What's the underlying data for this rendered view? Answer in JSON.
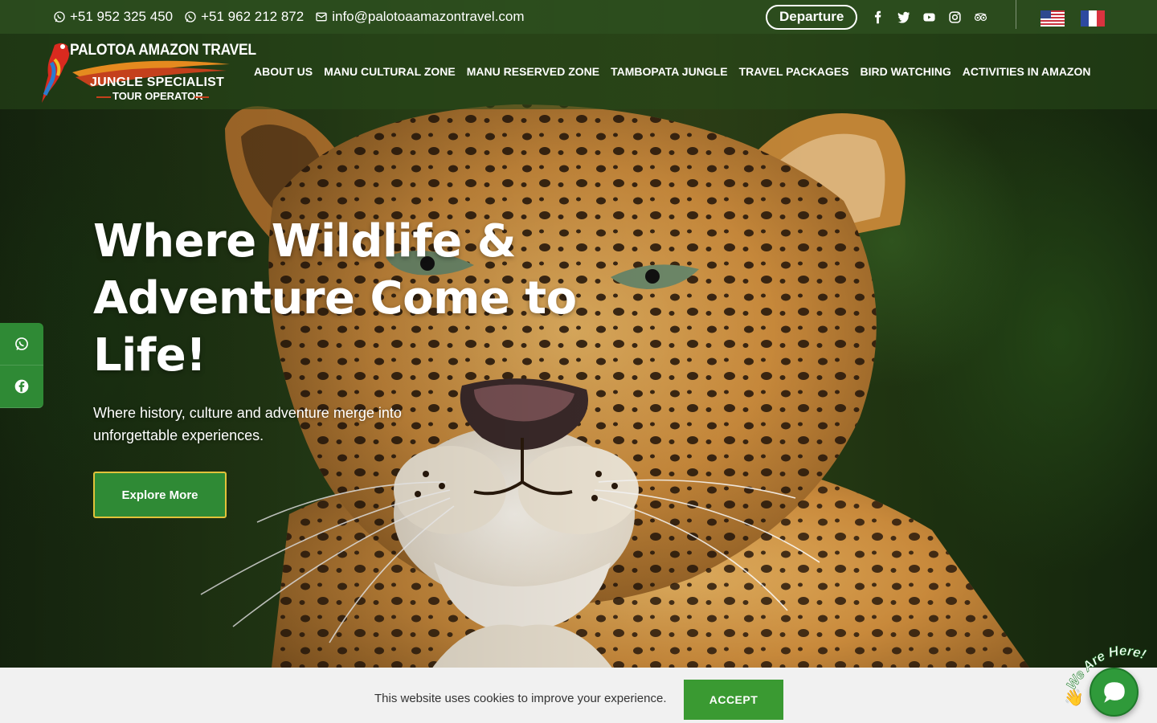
{
  "topbar": {
    "phone1": "+51 952 325 450",
    "phone2": "+51 962 212 872",
    "email": "info@palotoaamazontravel.com",
    "departure_label": "Departure",
    "social_icons": [
      "facebook-icon",
      "twitter-icon",
      "youtube-icon",
      "instagram-icon",
      "tripadvisor-icon"
    ],
    "flags": [
      "us-flag",
      "france-flag"
    ]
  },
  "logo": {
    "title": "PALOTOA AMAZON TRAVEL",
    "subtitle1": "JUNGLE SPECIALIST",
    "subtitle2": "TOUR OPERATOR"
  },
  "nav": {
    "items": [
      "ABOUT US",
      "MANU CULTURAL ZONE",
      "MANU RESERVED ZONE",
      "TAMBOPATA JUNGLE",
      "TRAVEL PACKAGES",
      "BIRD WATCHING",
      "ACTIVITIES IN AMAZON"
    ]
  },
  "hero": {
    "title": "Where Wildlife & Adventure Come to Life!",
    "subtitle": "Where history, culture and adventure merge into unforgettable experiences.",
    "button_label": "Explore More"
  },
  "cookie": {
    "text": "This website uses cookies to improve your experience.",
    "accept_label": "ACCEPT"
  },
  "chat": {
    "badge_text": "We Are Here!"
  },
  "colors": {
    "brand_green": "#2f8a35",
    "button_border": "#e2c23a",
    "topbar": "#2c4e1e"
  }
}
